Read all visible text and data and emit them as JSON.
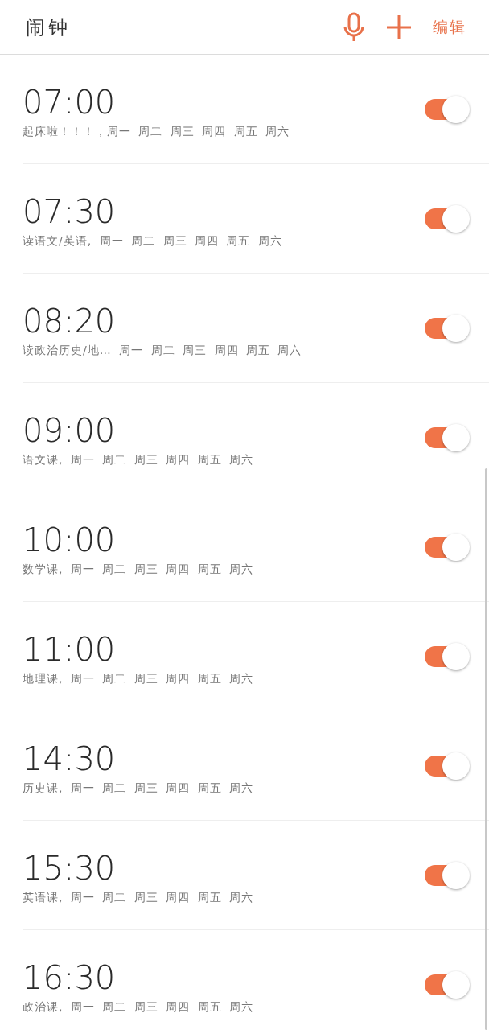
{
  "header": {
    "title": "闹钟",
    "edit_label": "编辑"
  },
  "alarms": [
    {
      "time": "07:00",
      "description": "起床啦！！！，周一 周二 周三 周四 周五 周六",
      "on": true
    },
    {
      "time": "07:30",
      "description": "读语文/英语, 周一 周二 周三 周四 周五 周六",
      "on": true
    },
    {
      "time": "08:20",
      "description": "读政治历史/地… 周一 周二 周三 周四 周五 周六",
      "on": true
    },
    {
      "time": "09:00",
      "description": "语文课, 周一 周二 周三 周四 周五 周六",
      "on": true
    },
    {
      "time": "10:00",
      "description": "数学课, 周一 周二 周三 周四 周五 周六",
      "on": true
    },
    {
      "time": "11:00",
      "description": "地理课, 周一 周二 周三 周四 周五 周六",
      "on": true
    },
    {
      "time": "14:30",
      "description": "历史课, 周一 周二 周三 周四 周五 周六",
      "on": true
    },
    {
      "time": "15:30",
      "description": "英语课, 周一 周二 周三 周四 周五 周六",
      "on": true
    },
    {
      "time": "16:30",
      "description": "政治课, 周一 周二 周三 周四 周五 周六",
      "on": true
    }
  ]
}
